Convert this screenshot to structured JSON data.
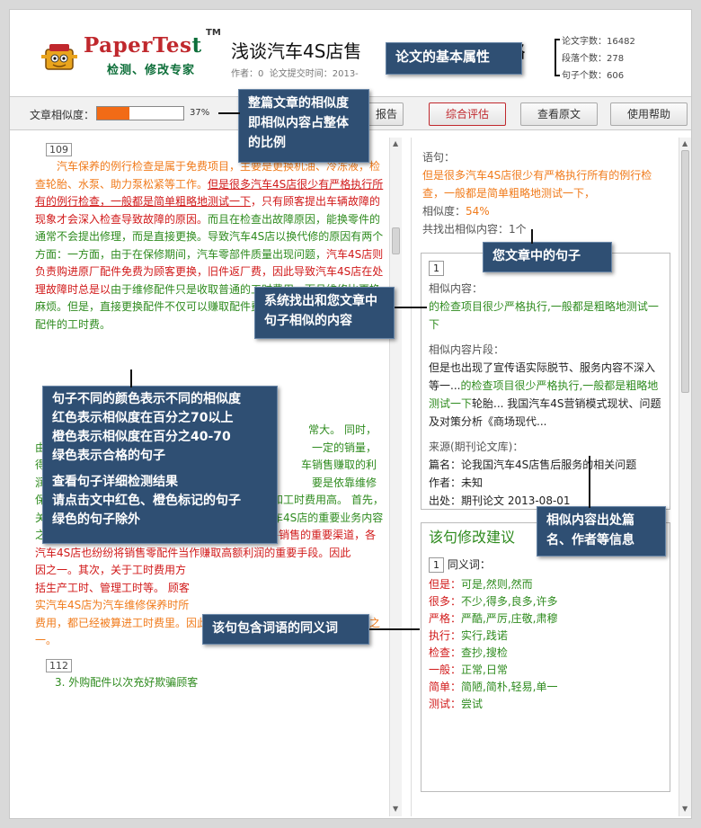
{
  "header": {
    "logo_main": "PaperTes",
    "logo_main_end": "t",
    "logo_tm": "TM",
    "logo_sub": "检测、修改专家",
    "title": "浅谈汽车4S店售",
    "title_end": "略",
    "meta_author_label": "作者：0",
    "meta_date_label": "论文提交时间：2013-",
    "stats": {
      "words": "论文字数：16482",
      "paragraphs": "段落个数：278",
      "sentences": "句子个数：606"
    }
  },
  "toolbar": {
    "similarity_label": "文章相似度：",
    "similarity_value": 0.37,
    "similarity_pct_text": "37%",
    "btn_report": "报告",
    "btn_overall": "综合评估",
    "btn_original": "查看原文",
    "btn_help": "使用帮助"
  },
  "left": {
    "para1_num": "109",
    "para1": {
      "s1": "汽车保养的例行检查是属于免费项目，主要是更换机油、冷冻液，检查轮胎、水泵、助力泵松紧等工作。",
      "s2": "但是很多汽车4S店很少有严格执行所有的例行检查，一般都是简单粗略地测试一下",
      "s3": "，只有顾客提出车辆故障的现象才会深入检查导致故障的原因。",
      "s4": "而且在检查出故障原因，能换零件的通常不会提出修理，而是直接更换。",
      "s5": "导致汽车4S店以换代修的原因有两个方面：一方面，由于在保修期间，汽车零部件质量出现问题，",
      "s6": "汽车4S店则负责购进原厂配件免费为顾客更换，旧件返厂",
      "s7": "费，因此导致汽车4S店在处理故障时总是以",
      "s8": "由于维修配件只是收取普通的工时费用，而且维修比更换麻烦。",
      "s9": "但是，直接更换配件不仅可以赚取配件费用，而且还可以赚取更换配件的工时费。"
    },
    "para2_frag": {
      "a": "常大。",
      "b": "同时，",
      "c": "由",
      "d": "一定的销量，",
      "e": "得",
      "f": "车销售赚取的利",
      "g": "润",
      "h": "要是依靠维修",
      "i": "保养。",
      "j": "维修保养费用高主要原因是更换配件费用高和工时费用",
      "k": "高。",
      "l": "首先，关于更换配件费用方面，由于汽车配件的供应是汽车4S店的重要业务内容之一。",
      "m": "许多汽车生产厂家都把汽车4S店当作零配件销售的重要渠道，各汽车4S店也纷纷将销售零配件当作赚取高额利润的重要手段。",
      "n": "因此",
      "o": "因之一。其次，关于工时费用方",
      "p": "括生产工时、管理工时等。",
      "q": "顾客",
      "r": "实汽车4S店为汽车维修保养时所",
      "s": "费用，都已经被算进工时费里。因此这也是导致维修保养费用高的原因之一。"
    },
    "para3_num": "112",
    "para3": "3. 外购配件以次充好欺骗顾客"
  },
  "right": {
    "sentence_label": "语句：",
    "sentence": "但是很多汽车4S店很少有严格执行所有的例行检查，一般都是简单粗略地测试一下，",
    "similarity_label": "相似度：",
    "similarity_value": "54%",
    "found_label": "共找出相似内容：1个",
    "card": {
      "num": "1",
      "similar_label": "相似内容：",
      "similar_text": "的检查项目很少严格执行,一般都是粗略地测试一下",
      "fragment_label": "相似内容片段：",
      "fragment_pre": "但是也出现了宣传语实际脱节、服务内容不深入等一...",
      "fragment_hit": "的检查项目很少严格执行,一般都是粗略地测试一下",
      "fragment_post": "轮胎... 我国汽车4S营销模式现状、问题及对策分析《商场现代...",
      "source_label": "来源(期刊论文库)：",
      "source_title": "篇名：论我国汽车4S店售后服务的相关问题",
      "source_author": "作者：未知",
      "source_pub": "出处：期刊论文 2013-08-01"
    },
    "suggest": {
      "title": "该句修改建议",
      "num": "1",
      "synonym_label": "同义词：",
      "synonyms": [
        {
          "k": "但是：",
          "v": "可是,然则,然而"
        },
        {
          "k": "很多：",
          "v": "不少,得多,良多,许多"
        },
        {
          "k": "严格：",
          "v": "严酷,严厉,庄敬,肃穆"
        },
        {
          "k": "执行：",
          "v": "实行,践诺"
        },
        {
          "k": "检查：",
          "v": "查抄,搜检"
        },
        {
          "k": "一般：",
          "v": "正常,日常"
        },
        {
          "k": "简单：",
          "v": "简陋,简朴,轻易,单一"
        },
        {
          "k": "测试：",
          "v": "尝试"
        }
      ]
    }
  },
  "callouts": {
    "basic_attr": "论文的基本属性",
    "similarity": "整篇文章的相似度即相似内容占整体的比例",
    "your_sentence": "您文章中的句子",
    "similar_found": "系统找出和您文章中句子相似的内容",
    "colors": {
      "l1": "句子不同的颜色表示不同的相似度",
      "l2": "红色表示相似度在百分之70以上",
      "l3": "橙色表示相似度在百分之40-70",
      "l4": "绿色表示合格的句子",
      "l5": "查看句子详细检测结果",
      "l6": "请点击文中红色、橙色标记的句子",
      "l7": "绿色的句子除外"
    },
    "source_info": "相似内容出处篇名、作者等信息",
    "synonym_info": "该句包含词语的同义词"
  }
}
